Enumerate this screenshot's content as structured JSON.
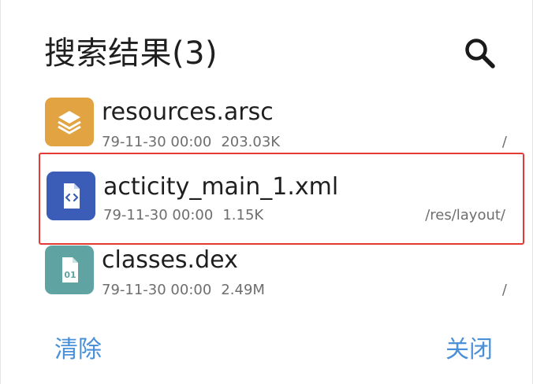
{
  "dialog": {
    "title": "搜索结果(3)",
    "search_icon": "search-icon"
  },
  "files": [
    {
      "name": "resources.arsc",
      "date": "79-11-30 00:00",
      "size": "203.03K",
      "path": "/",
      "icon": "layers-icon",
      "icon_color": "#E2A443",
      "highlighted": false
    },
    {
      "name": "acticity_main_1.xml",
      "date": "79-11-30 00:00",
      "size": "1.15K",
      "path": "/res/layout/",
      "icon": "code-file-icon",
      "icon_color": "#3B5DB8",
      "highlighted": true
    },
    {
      "name": "classes.dex",
      "date": "79-11-30 00:00",
      "size": "2.49M",
      "path": "/",
      "icon": "binary-file-icon",
      "icon_color": "#5FA3A3",
      "highlighted": false
    }
  ],
  "actions": {
    "clear_label": "清除",
    "close_label": "关闭"
  },
  "colors": {
    "accent": "#4A90D9",
    "highlight_border": "#E53935"
  }
}
